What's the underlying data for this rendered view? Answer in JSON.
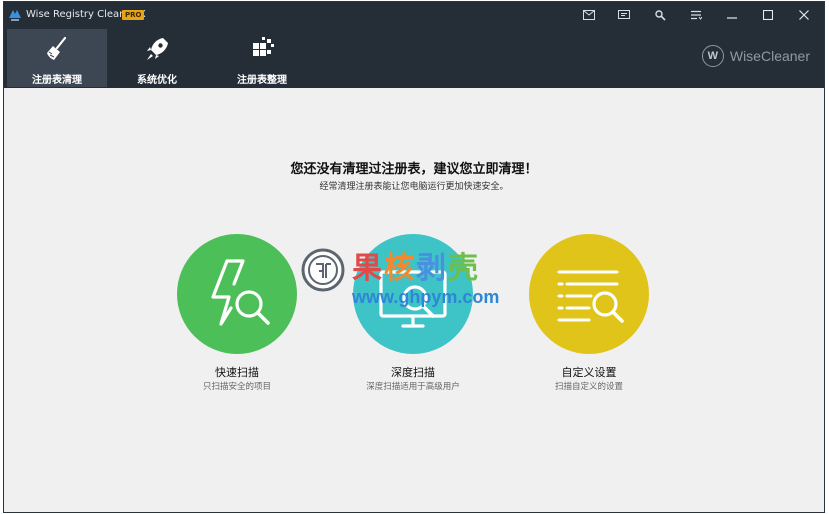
{
  "titlebar": {
    "app_title": "Wise Registry Cleaner X",
    "badge": "PRO",
    "icons": [
      "mail-icon",
      "feedback-icon",
      "tools-icon",
      "menu-icon",
      "minimize-icon",
      "maximize-icon",
      "close-icon"
    ]
  },
  "nav": {
    "tabs": [
      {
        "label": "注册表清理",
        "icon": "broom-icon",
        "active": true
      },
      {
        "label": "系统优化",
        "icon": "rocket-icon",
        "active": false
      },
      {
        "label": "注册表整理",
        "icon": "defrag-icon",
        "active": false
      }
    ],
    "brand_letter": "W",
    "brand_name": "WiseCleaner"
  },
  "main": {
    "headline": "您还没有清理过注册表，建议您立即清理！",
    "subline": "经常清理注册表能让您电脑运行更加快速安全。",
    "options": [
      {
        "title": "快速扫描",
        "desc": "只扫描安全的项目",
        "color": "#4cbf58",
        "icon": "lightning-search-icon"
      },
      {
        "title": "深度扫描",
        "desc": "深度扫描适用于高级用户",
        "color": "#3ec4c6",
        "icon": "monitor-search-icon"
      },
      {
        "title": "自定义设置",
        "desc": "扫描自定义的设置",
        "color": "#e0c41a",
        "icon": "list-search-icon"
      }
    ]
  },
  "watermark": {
    "cn_text": "果核剥壳",
    "url": "www.ghpym.com"
  },
  "colors": {
    "titlebar_bg": "#252d37",
    "active_tab_bg": "#3d4754",
    "content_bg": "#f0f0f0"
  }
}
